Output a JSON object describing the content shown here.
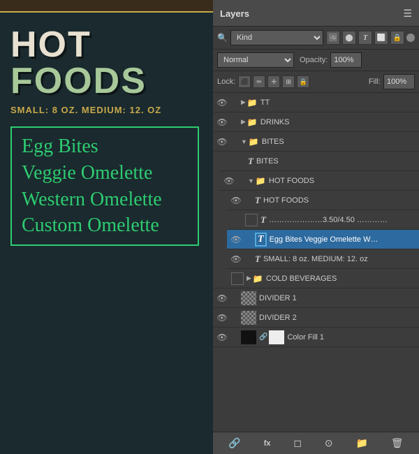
{
  "left": {
    "title_line1": "HOT",
    "title_line2": "FOODS",
    "subtitle": "SMALL: 8 OZ. MEDIUM: 12. OZ",
    "menu_items": [
      "Egg Bites",
      "Veggie Omelette",
      "Western Omelette",
      "Custom Omelette"
    ]
  },
  "layers": {
    "title": "Layers",
    "menu_icon": "☰",
    "filter": {
      "label": "Kind",
      "placeholder": "Kind"
    },
    "blend_mode": "Normal",
    "opacity_label": "Opacity:",
    "opacity_value": "100%",
    "lock_label": "Lock:",
    "fill_label": "Fill:",
    "fill_value": "100%",
    "items": [
      {
        "id": "tt",
        "name": "TT",
        "type": "folder",
        "indent": 0,
        "has_eye": true,
        "has_arrow": true,
        "folder_color": "orange"
      },
      {
        "id": "drinks",
        "name": "DRINKS",
        "type": "folder",
        "indent": 0,
        "has_eye": true,
        "has_arrow": true,
        "folder_color": "orange"
      },
      {
        "id": "bites",
        "name": "BITES",
        "type": "folder",
        "indent": 0,
        "has_eye": true,
        "has_arrow": true,
        "folder_color": "teal",
        "open": true
      },
      {
        "id": "bites-t",
        "name": "BITES",
        "type": "text",
        "indent": 1,
        "has_eye": false
      },
      {
        "id": "hot-foods-folder",
        "name": "HOT FOODS",
        "type": "folder",
        "indent": 1,
        "has_eye": true,
        "has_arrow": true,
        "folder_color": "teal",
        "open": true
      },
      {
        "id": "hot-foods-t",
        "name": "HOT FOODS",
        "type": "text",
        "indent": 2,
        "has_eye": true
      },
      {
        "id": "dotted",
        "name": "…………………3.50/4.50 …………",
        "type": "text",
        "indent": 2,
        "has_eye": false,
        "has_checkbox": true
      },
      {
        "id": "egg-bites",
        "name": "Egg Bites Veggie Omelette W…",
        "type": "text",
        "indent": 2,
        "has_eye": true,
        "selected": true
      },
      {
        "id": "small-8oz",
        "name": "SMALL: 8 oz. MEDIUM: 12. oz",
        "type": "text",
        "indent": 2,
        "has_eye": true
      },
      {
        "id": "cold-beverages",
        "name": "COLD BEVERAGES",
        "type": "folder",
        "indent": 0,
        "has_eye": false,
        "has_arrow": true,
        "has_checkbox": true,
        "folder_color": "orange"
      },
      {
        "id": "divider1",
        "name": "DIVIDER 1",
        "type": "image",
        "indent": 0,
        "has_eye": true
      },
      {
        "id": "divider2",
        "name": "DIVIDER 2",
        "type": "image",
        "indent": 0,
        "has_eye": true
      },
      {
        "id": "color-fill-1",
        "name": "Color Fill 1",
        "type": "color-fill",
        "indent": 0,
        "has_eye": true
      }
    ],
    "toolbar_buttons": [
      "🔗",
      "fx",
      "◻",
      "⊙",
      "📁",
      "🗑"
    ]
  }
}
